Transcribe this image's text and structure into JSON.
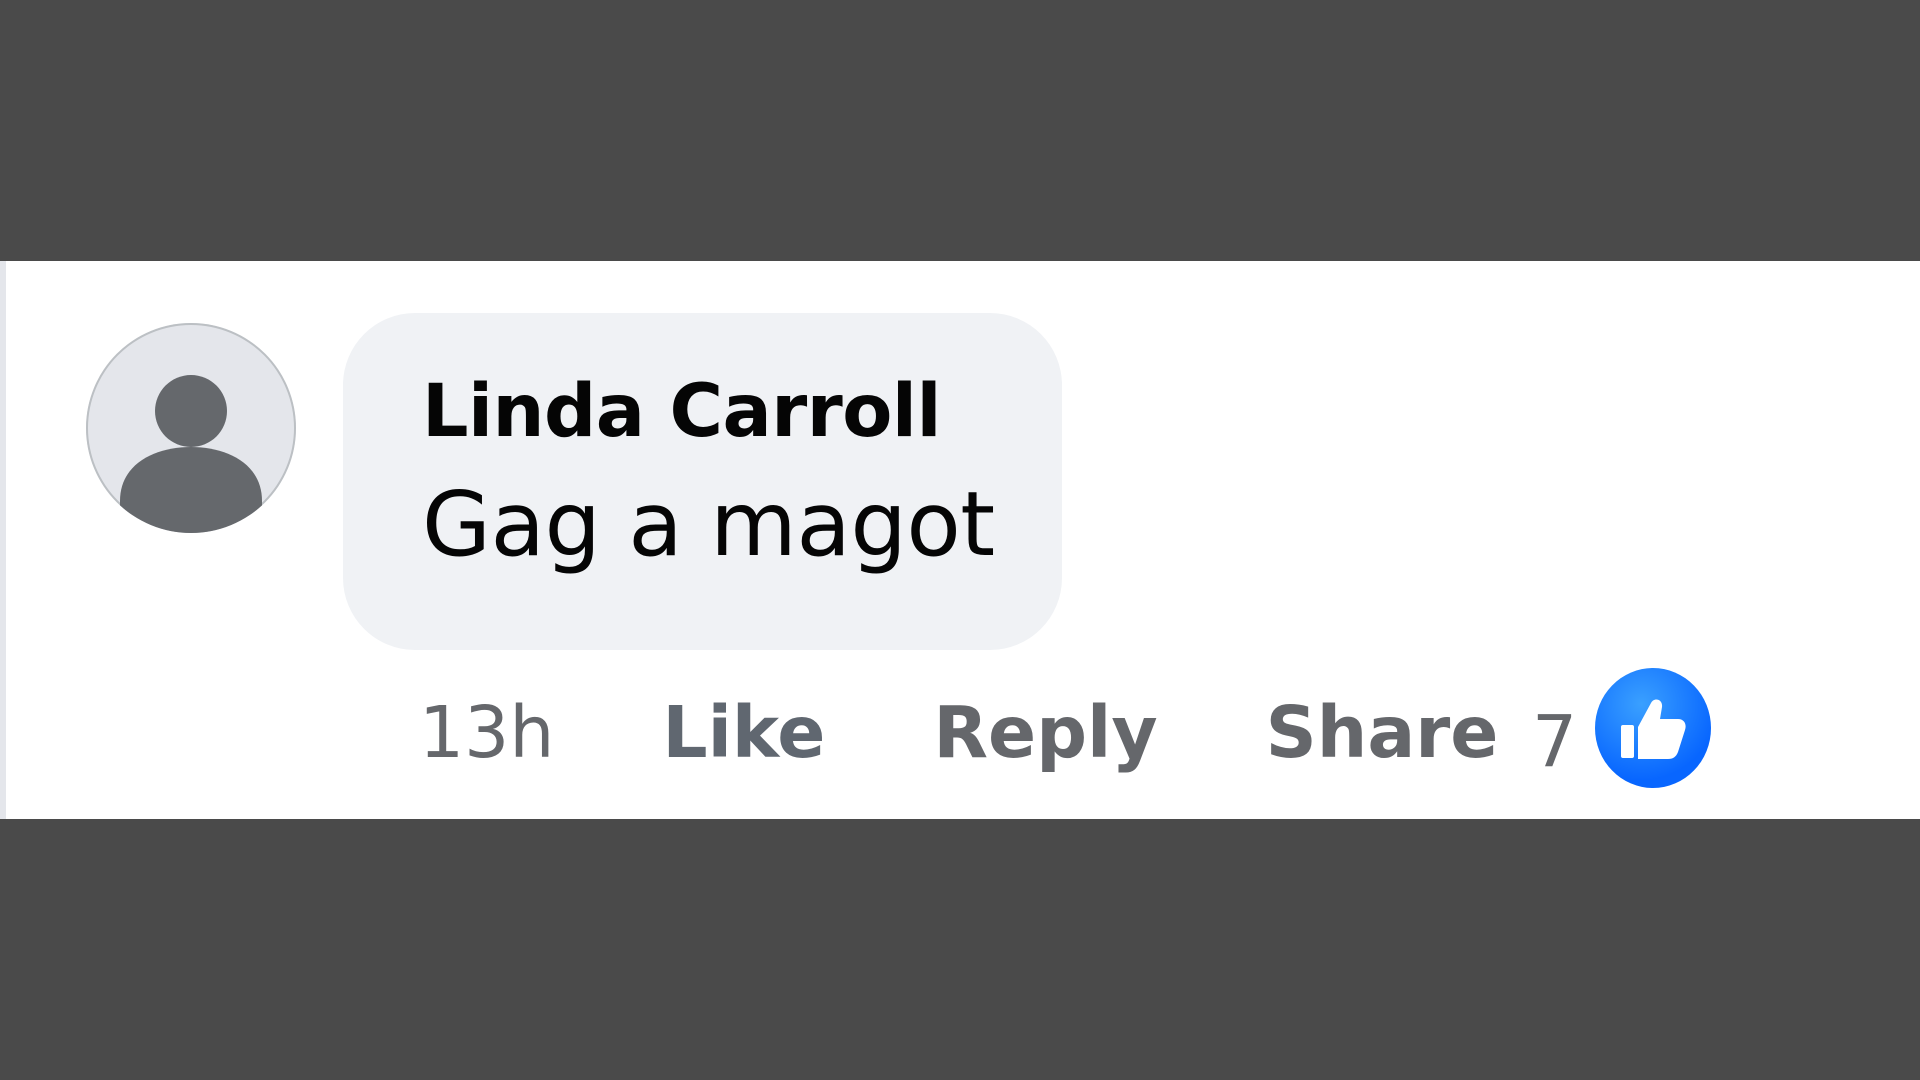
{
  "comment": {
    "author": "Linda Carroll",
    "text": "Gag a magot",
    "avatar_icon": "default-user-silhouette-icon"
  },
  "actions": {
    "time": "13h",
    "like_label": "Like",
    "reply_label": "Reply",
    "share_label": "Share"
  },
  "reactions": {
    "count": "7",
    "icon": "thumbs-up-icon",
    "badge_color": "#0866ff"
  }
}
